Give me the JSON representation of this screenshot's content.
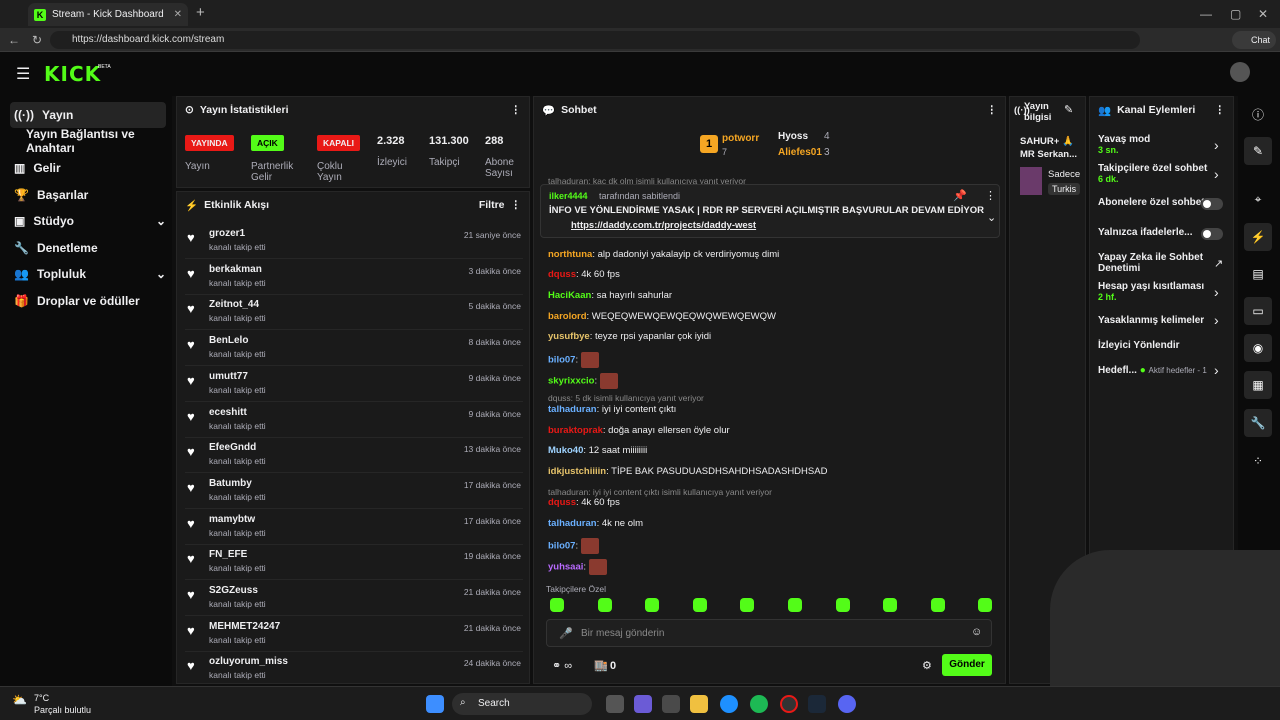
{
  "browser": {
    "tab_title": "Stream - Kick Dashboard",
    "url": "https://dashboard.kick.com/stream",
    "chat_label": "Chat"
  },
  "brand": {
    "logo": "KICK",
    "beta": "BETA",
    "accent": "#53fc18"
  },
  "sidebar": {
    "items": [
      {
        "label": "Yayın",
        "icon": "broadcast-icon"
      },
      {
        "label": "Yayın Bağlantısı ve Anahtarı",
        "icon": ""
      },
      {
        "label": "Gelir",
        "icon": "chart-icon"
      },
      {
        "label": "Başarılar",
        "icon": "trophy-icon"
      },
      {
        "label": "Stüdyo",
        "icon": "studio-icon"
      },
      {
        "label": "Denetleme",
        "icon": "wrench-icon"
      },
      {
        "label": "Topluluk",
        "icon": "users-icon"
      },
      {
        "label": "Droplar ve ödüller",
        "icon": "gift-icon"
      }
    ]
  },
  "stats": {
    "title": "Yayın İstatistikleri",
    "badges": [
      {
        "text": "YAYINDA",
        "label": "Yayın",
        "color": "#e91916"
      },
      {
        "text": "AÇIK",
        "label": "Partnerlik Gelir",
        "color": "#53fc18"
      },
      {
        "text": "KAPALI",
        "label": "Çoklu Yayın",
        "color": "#e91916"
      }
    ],
    "numbers": [
      {
        "value": "2.328",
        "label": "İzleyici"
      },
      {
        "value": "131.300",
        "label": "Takipçi"
      },
      {
        "value": "288",
        "label": "Abone Sayısı"
      }
    ]
  },
  "activity": {
    "title": "Etkinlik Akışı",
    "filter": "Filtre",
    "sub": "kanalı takip etti",
    "items": [
      {
        "name": "grozer1",
        "time": "21 saniye önce"
      },
      {
        "name": "berkakman",
        "time": "3 dakika önce"
      },
      {
        "name": "Zeitnot_44",
        "time": "5 dakika önce"
      },
      {
        "name": "BenLelo",
        "time": "8 dakika önce"
      },
      {
        "name": "umutt77",
        "time": "9 dakika önce"
      },
      {
        "name": "eceshitt",
        "time": "9 dakika önce"
      },
      {
        "name": "EfeeGndd",
        "time": "13 dakika önce"
      },
      {
        "name": "Batumby",
        "time": "17 dakika önce"
      },
      {
        "name": "mamybtw",
        "time": "17 dakika önce"
      },
      {
        "name": "FN_EFE",
        "time": "19 dakika önce"
      },
      {
        "name": "S2GZeuss",
        "time": "21 dakika önce"
      },
      {
        "name": "MEHMET24247",
        "time": "21 dakika önce"
      },
      {
        "name": "ozluyorum_miss",
        "time": "24 dakika önce"
      }
    ]
  },
  "chat": {
    "title": "Sohbet",
    "top": [
      {
        "rank": "1",
        "name": "potworr",
        "count": "7"
      },
      {
        "name": "Hyoss",
        "count": "4"
      },
      {
        "name": "Aliefes01",
        "count": "3"
      }
    ],
    "pinned": {
      "by": "ilker4444",
      "by_suffix": "tarafından sabitlendi",
      "text": "İNFO VE YÖNLENDİRME YASAK | RDR RP SERVERİ AÇILMIŞTIR BAŞVURULAR DEVAM EDİYOR",
      "link": "https://daddy.com.tr/projects/daddy-west"
    },
    "reply_top": "talhaduran: kaç dk olm isimli kullanıcıya yanıt veriyor",
    "messages": [
      {
        "user": "northtuna",
        "color": "#f5a623",
        "text": ": alp dadoniyi yakalayip ck verdiriyomuş dimi"
      },
      {
        "user": "dquss",
        "color": "#e91916",
        "text": ": 4k 60 fps"
      },
      {
        "user": "HaciKaan",
        "color": "#53fc18",
        "text": ": sa hayırlı sahurlar"
      },
      {
        "user": "barolord",
        "color": "#f5a623",
        "text": ": WEQEQWEWQEWQEQWQWEWQEWQW"
      },
      {
        "user": "yusufbye",
        "color": "#e6c36a",
        "text": ": teyze rpsi yapanlar çok iyidi"
      },
      {
        "user": "bilo07",
        "color": "#6ab0ff",
        "text": ":"
      },
      {
        "user": "skyrixxcio",
        "color": "#53fc18",
        "text": ":"
      },
      {
        "user": "talhaduran",
        "color": "#6ab0ff",
        "text": ": iyi iyi content çıktı"
      },
      {
        "user": "buraktoprak",
        "color": "#e91916",
        "text": ": doğa anayı ellersen öyle olur"
      },
      {
        "user": "Muko40",
        "color": "#9fd3ff",
        "text": ": 12 saat miiiiiiii"
      },
      {
        "user": "idkjustchiiiin",
        "color": "#e6c36a",
        "text": ": TİPE BAK PASUDUASDHSAHDHSADASHDHSAD"
      },
      {
        "user": "dquss",
        "color": "#e91916",
        "text": ": 4k 60 fps"
      },
      {
        "user": "talhaduran",
        "color": "#6ab0ff",
        "text": ": 4k ne olm"
      },
      {
        "user": "bilo07",
        "color": "#6ab0ff",
        "text": ":"
      },
      {
        "user": "yuhsaai",
        "color": "#b96bff",
        "text": ":"
      }
    ],
    "reply_1": "dquss: 5 dk isimli kullanıcıya yanıt veriyor",
    "reply_2": "talhaduran: iyi iyi content çıktı isimli kullanıcıya yanıt veriyor",
    "followers_only": "Takipçilere Özel",
    "input_placeholder": "Bir mesaj gönderin",
    "points": "0",
    "send": "Gönder"
  },
  "stream_info": {
    "title": "Yayın bilgisi",
    "name": "SAHUR+ 🙏 MR Serkan...",
    "sub": "Sadece",
    "lang": "Turkis"
  },
  "channel_actions": {
    "title": "Kanal Eylemleri",
    "items": [
      {
        "label": "Yavaş mod",
        "value": "3 sn."
      },
      {
        "label": "Takipçilere özel sohbet",
        "value": "6 dk."
      },
      {
        "label": "Abonelere özel sohbet",
        "value": ""
      },
      {
        "label": "Yalnızca ifadelerle...",
        "value": ""
      },
      {
        "label": "Yapay Zeka ile Sohbet Denetimi",
        "value": ""
      },
      {
        "label": "Hesap yaşı kısıtlaması",
        "value": "2 hf."
      },
      {
        "label": "Yasaklanmış kelimeler",
        "value": ""
      },
      {
        "label": "İzleyici Yönlendir",
        "value": ""
      },
      {
        "label": "Hedefl...",
        "value": "Aktif hedefler - 1"
      }
    ]
  },
  "taskbar": {
    "temp": "7°C",
    "weather": "Parçalı bulutlu",
    "search": "Search"
  }
}
